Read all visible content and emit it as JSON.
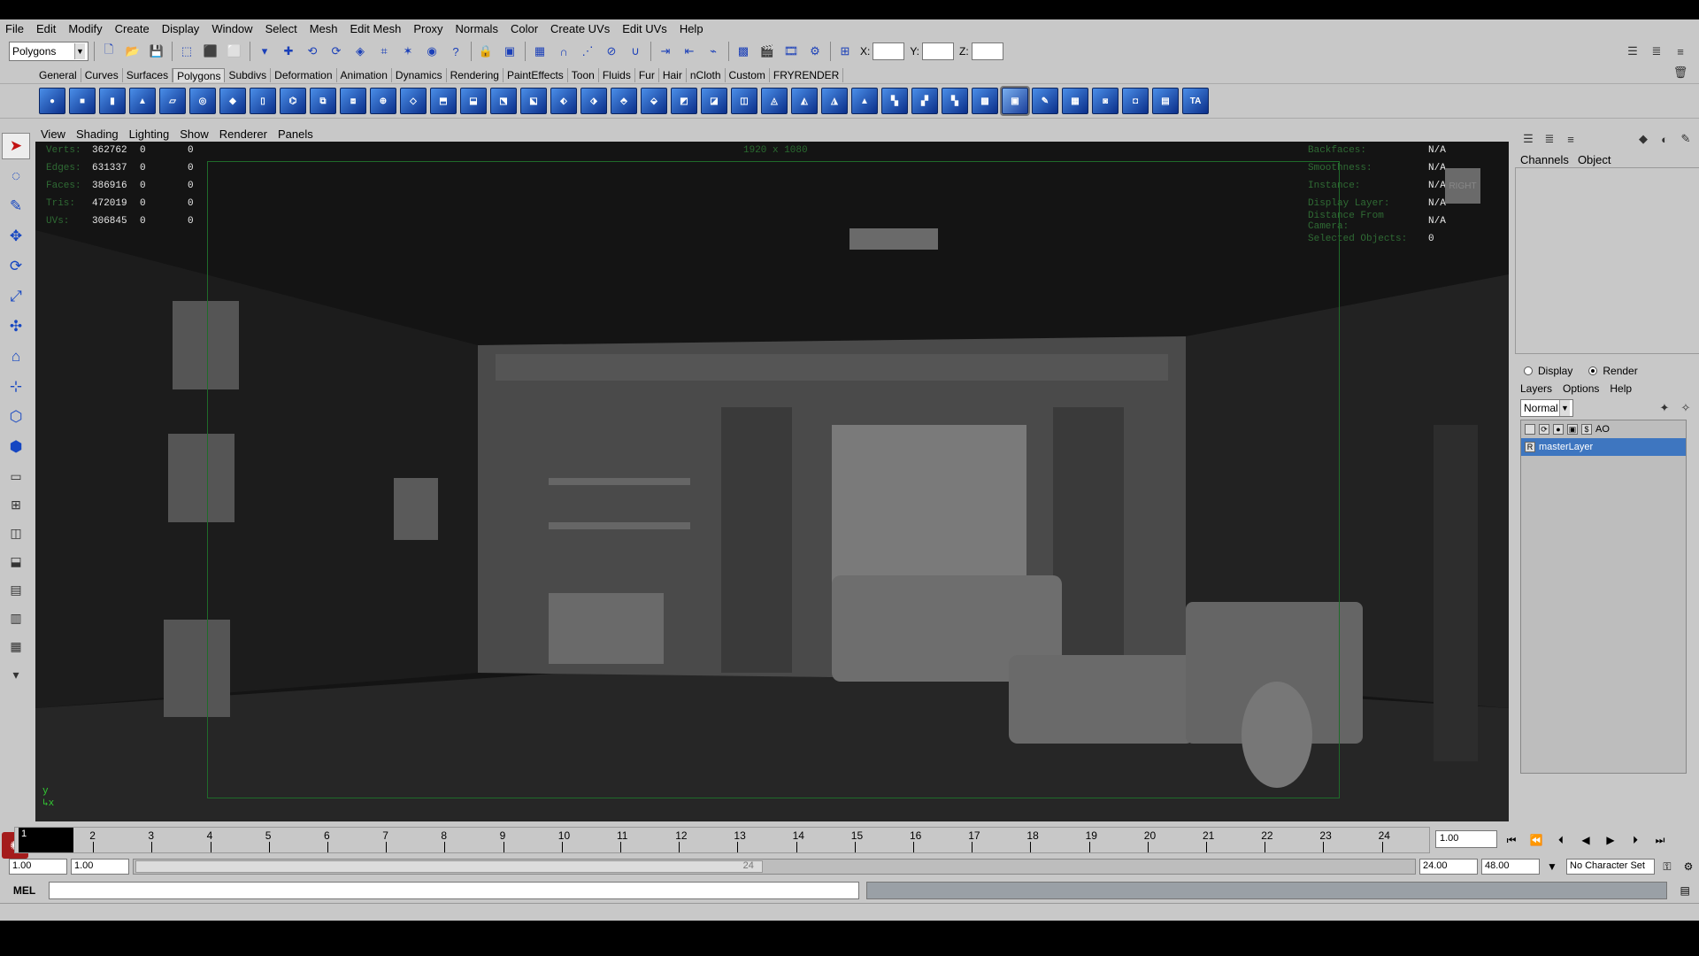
{
  "menubar": [
    "File",
    "Edit",
    "Modify",
    "Create",
    "Display",
    "Window",
    "Select",
    "Mesh",
    "Edit Mesh",
    "Proxy",
    "Normals",
    "Color",
    "Create UVs",
    "Edit UVs",
    "Help"
  ],
  "toolbar": {
    "mode_select": "Polygons",
    "x_label": "X:",
    "y_label": "Y:",
    "z_label": "Z:"
  },
  "shelf_tabs": [
    "General",
    "Curves",
    "Surfaces",
    "Polygons",
    "Subdivs",
    "Deformation",
    "Animation",
    "Dynamics",
    "Rendering",
    "PaintEffects",
    "Toon",
    "Fluids",
    "Fur",
    "Hair",
    "nCloth",
    "Custom",
    "FRYRENDER"
  ],
  "active_shelf_tab": "Polygons",
  "shelf_last_icon_label": "TA",
  "panel_menu": [
    "View",
    "Shading",
    "Lighting",
    "Show",
    "Renderer",
    "Panels"
  ],
  "hud": {
    "left": [
      {
        "label": "Verts:",
        "v1": "362762",
        "v2": "0",
        "v3": "0"
      },
      {
        "label": "Edges:",
        "v1": "631337",
        "v2": "0",
        "v3": "0"
      },
      {
        "label": "Faces:",
        "v1": "386916",
        "v2": "0",
        "v3": "0"
      },
      {
        "label": "Tris:",
        "v1": "472019",
        "v2": "0",
        "v3": "0"
      },
      {
        "label": "UVs:",
        "v1": "306845",
        "v2": "0",
        "v3": "0"
      }
    ],
    "right": [
      {
        "label": "Backfaces:",
        "value": "N/A"
      },
      {
        "label": "Smoothness:",
        "value": "N/A"
      },
      {
        "label": "Instance:",
        "value": "N/A"
      },
      {
        "label": "Display Layer:",
        "value": "N/A"
      },
      {
        "label": "Distance From Camera:",
        "value": "N/A"
      },
      {
        "label": "Selected Objects:",
        "value": "0"
      }
    ],
    "resolution": "1920 x 1080",
    "view_cube": "RIGHT"
  },
  "channel_box": {
    "tabs": [
      "Channels",
      "Object"
    ],
    "display_label": "Display",
    "render_label": "Render",
    "layer_menu": [
      "Layers",
      "Options",
      "Help"
    ],
    "blend_mode": "Normal",
    "layers": [
      {
        "name": "AO",
        "selected": false
      },
      {
        "name": "masterLayer",
        "selected": true
      }
    ]
  },
  "timeline": {
    "start_marker": "1",
    "ticks": [
      "1",
      "2",
      "3",
      "4",
      "5",
      "6",
      "7",
      "8",
      "9",
      "10",
      "11",
      "12",
      "13",
      "14",
      "15",
      "16",
      "17",
      "18",
      "19",
      "20",
      "21",
      "22",
      "23",
      "24"
    ],
    "current_frame": "1.00"
  },
  "range": {
    "start": "1.00",
    "anim_start": "1.00",
    "anim_end": "24.00",
    "end": "48.00",
    "slider_label": "24",
    "char_set": "No Character Set"
  },
  "cmd": {
    "mel_label": "MEL"
  },
  "colors": {
    "ui_bg": "#c8c8c8",
    "viewport_bg": "#141414",
    "hud_green": "#2f6b34",
    "layer_selected": "#3e76c0"
  }
}
